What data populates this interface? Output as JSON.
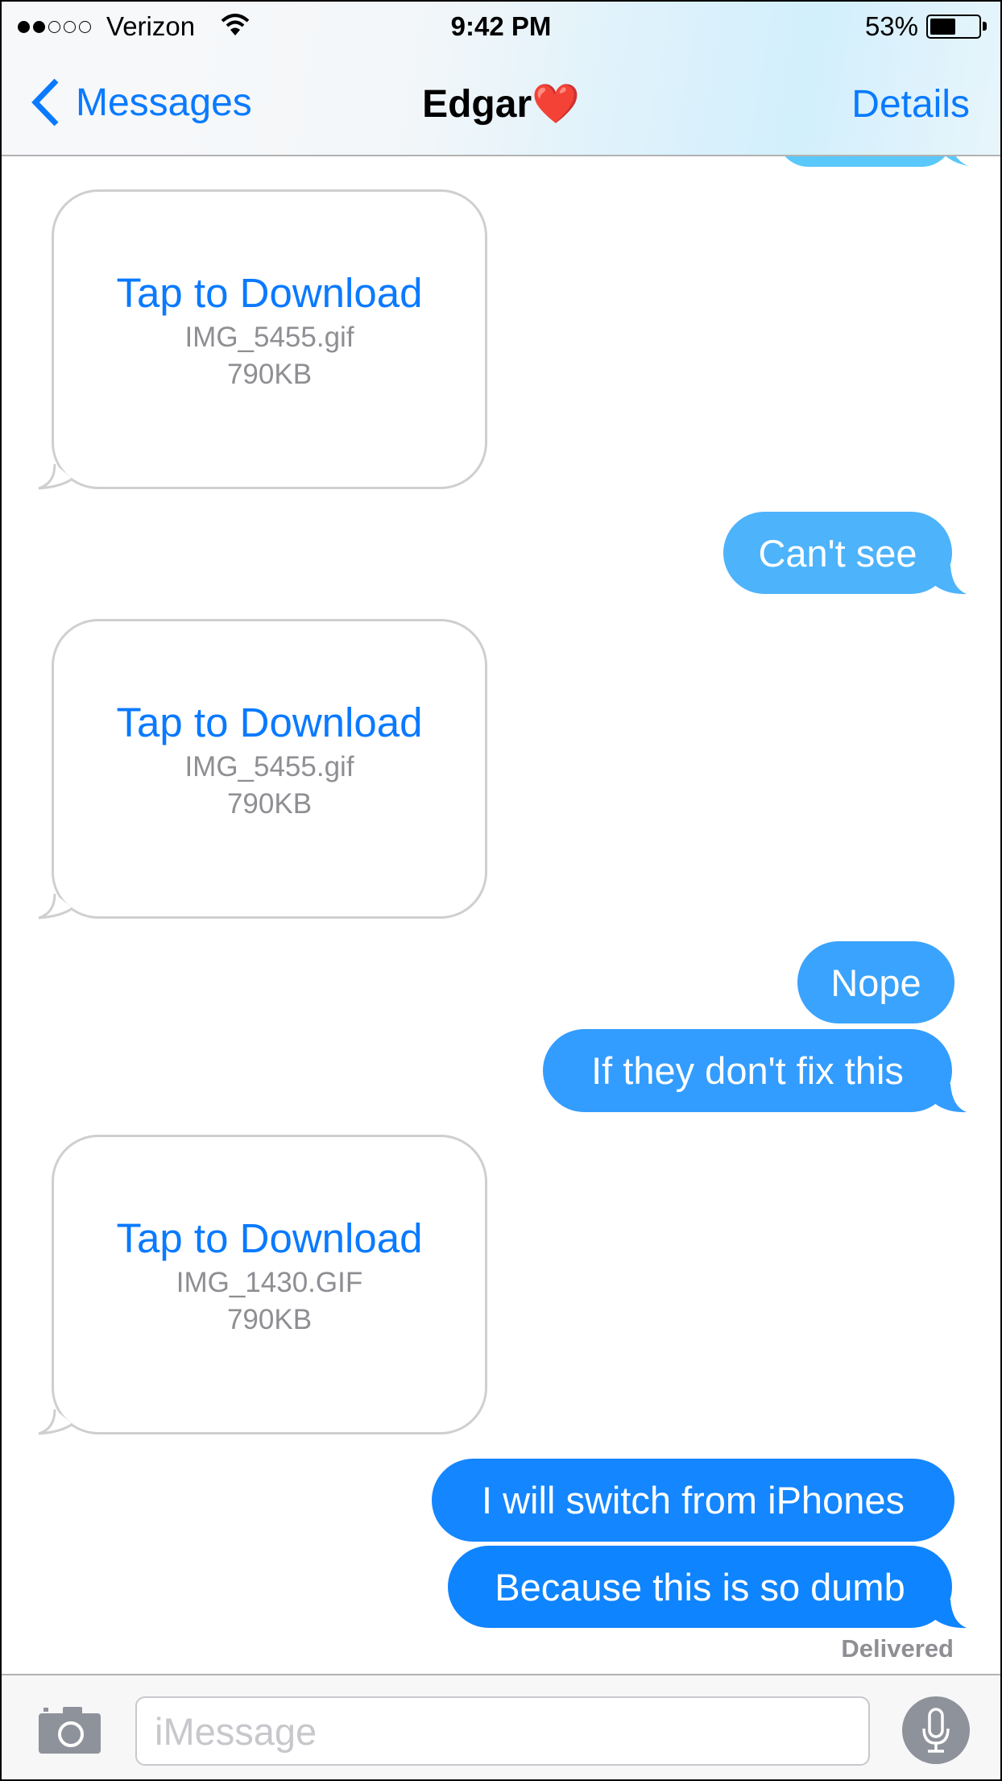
{
  "status_bar": {
    "signal_bars_filled": 2,
    "signal_bars_total": 5,
    "carrier": "Verizon",
    "time": "9:42 PM",
    "battery_percent": "53%",
    "battery_level": 0.53
  },
  "nav": {
    "back_label": "Messages",
    "title": "Edgar",
    "title_emoji": "❤️",
    "details_label": "Details"
  },
  "colors": {
    "accent": "#0a7aff",
    "sent_light": "#5ac8fa",
    "sent_mid": "#3399ff",
    "sent_dark": "#0f84ff",
    "attachment_border": "#cfcfcf",
    "secondary_text": "#8e8e93"
  },
  "messages": [
    {
      "type": "attachment",
      "direction": "received",
      "action": "Tap to Download",
      "filename": "IMG_5455.gif",
      "size": "790KB"
    },
    {
      "type": "text",
      "direction": "sent",
      "text": "Can't see"
    },
    {
      "type": "attachment",
      "direction": "received",
      "action": "Tap to Download",
      "filename": "IMG_5455.gif",
      "size": "790KB"
    },
    {
      "type": "text",
      "direction": "sent",
      "text": "Nope"
    },
    {
      "type": "text",
      "direction": "sent",
      "text": "If they don't fix this"
    },
    {
      "type": "attachment",
      "direction": "received",
      "action": "Tap to Download",
      "filename": "IMG_1430.GIF",
      "size": "790KB"
    },
    {
      "type": "text",
      "direction": "sent",
      "text": "I will switch from iPhones"
    },
    {
      "type": "text",
      "direction": "sent",
      "text": "Because this is so dumb"
    }
  ],
  "delivery_status": "Delivered",
  "input": {
    "placeholder": "iMessage",
    "value": ""
  },
  "icons": {
    "camera": "camera-icon",
    "mic": "microphone-icon",
    "back": "chevron-left-icon"
  }
}
